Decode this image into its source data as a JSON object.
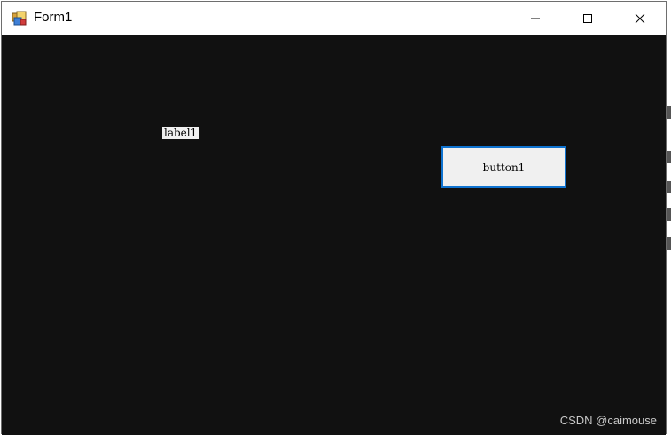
{
  "window": {
    "title": "Form1"
  },
  "titlebar": {
    "icon": "app-form-icon",
    "minimize_icon": "minimize-icon",
    "maximize_icon": "maximize-icon",
    "close_icon": "close-icon"
  },
  "form": {
    "background_color": "#111111",
    "label1_text": "label1",
    "button1_text": "button1",
    "button_focus_color": "#0f73d0"
  },
  "watermark": {
    "text": "CSDN @caimouse"
  }
}
